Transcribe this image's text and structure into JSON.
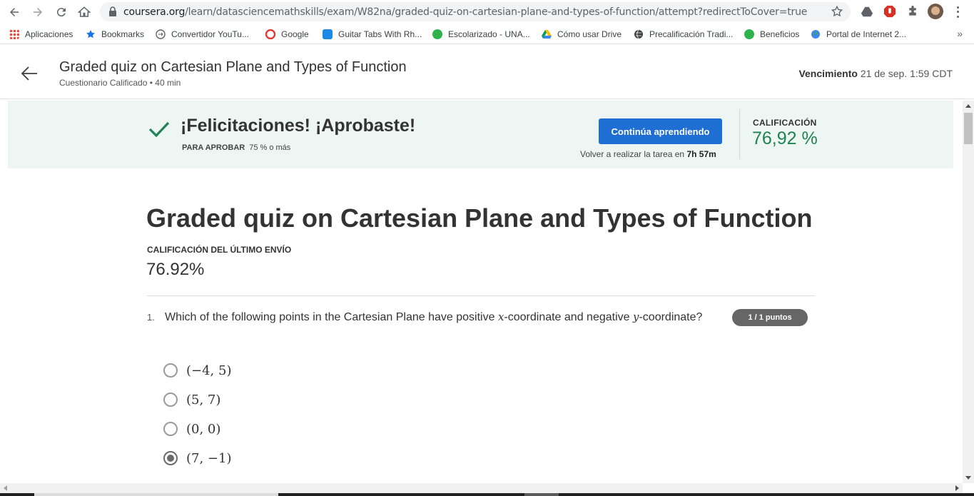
{
  "browser": {
    "url_host": "coursera.org",
    "url_path": "/learn/datasciencemathskills/exam/W82na/graded-quiz-on-cartesian-plane-and-types-of-function/attempt?redirectToCover=true",
    "bookmarks": [
      {
        "label": "Aplicaciones",
        "icon": "apps-grid-icon",
        "color": "#ea4335"
      },
      {
        "label": "Bookmarks",
        "icon": "star-icon",
        "color": "#1a73e8"
      },
      {
        "label": "Convertidor YouTu...",
        "icon": "converter-icon",
        "color": "#5f6368"
      },
      {
        "label": "Google",
        "icon": "opera-icon",
        "color": "#e53935"
      },
      {
        "label": "Guitar Tabs With Rh...",
        "icon": "guitar-tabs-icon",
        "color": "#1e88e5"
      },
      {
        "label": "Escolarizado - UNA...",
        "icon": "escolarizado-icon",
        "color": "#2eb34a"
      },
      {
        "label": "Cómo usar Drive",
        "icon": "drive-icon",
        "color": "#fbbc04"
      },
      {
        "label": "Precalificación Tradi...",
        "icon": "globe-icon",
        "color": "#3c4043"
      },
      {
        "label": "Beneficios",
        "icon": "beneficios-icon",
        "color": "#2eb34a"
      },
      {
        "label": "Portal de Internet 2...",
        "icon": "globe-color-icon",
        "color": "#4285f4"
      }
    ],
    "more": "»"
  },
  "header": {
    "title": "Graded quiz on Cartesian Plane and Types of Function",
    "subtitle": "Cuestionario Calificado • 40 min",
    "due_label": "Vencimiento",
    "due_value": "21 de sep. 1:59 CDT"
  },
  "banner": {
    "message": "¡Felicitaciones! ¡Aprobaste!",
    "pass_label": "PARA APROBAR",
    "pass_value": "75 % o más",
    "continue_label": "Continúa aprendiendo",
    "retry_prefix": "Volver a realizar la tarea en",
    "retry_time": "7h 57m",
    "grade_label": "CALIFICACIÓN",
    "grade_value": "76,92 %",
    "accent_color": "#1f8354"
  },
  "main": {
    "title": "Graded quiz on Cartesian Plane and Types of Function",
    "last_grade_label": "CALIFICACIÓN DEL ÚLTIMO ENVÍO",
    "last_grade_value": "76.92%",
    "question": {
      "number": "1.",
      "text_a": "Which of the following points in the Cartesian Plane have positive ",
      "var_x": "x",
      "text_b": "-coordinate and negative ",
      "var_y": "y",
      "text_c": "-coordinate?",
      "points": "1 / 1 puntos",
      "options": [
        {
          "label": "(−4, 5)",
          "selected": false
        },
        {
          "label": "(5, 7)",
          "selected": false
        },
        {
          "label": "(0, 0)",
          "selected": false
        },
        {
          "label": "(7, −1)",
          "selected": true
        }
      ]
    }
  }
}
